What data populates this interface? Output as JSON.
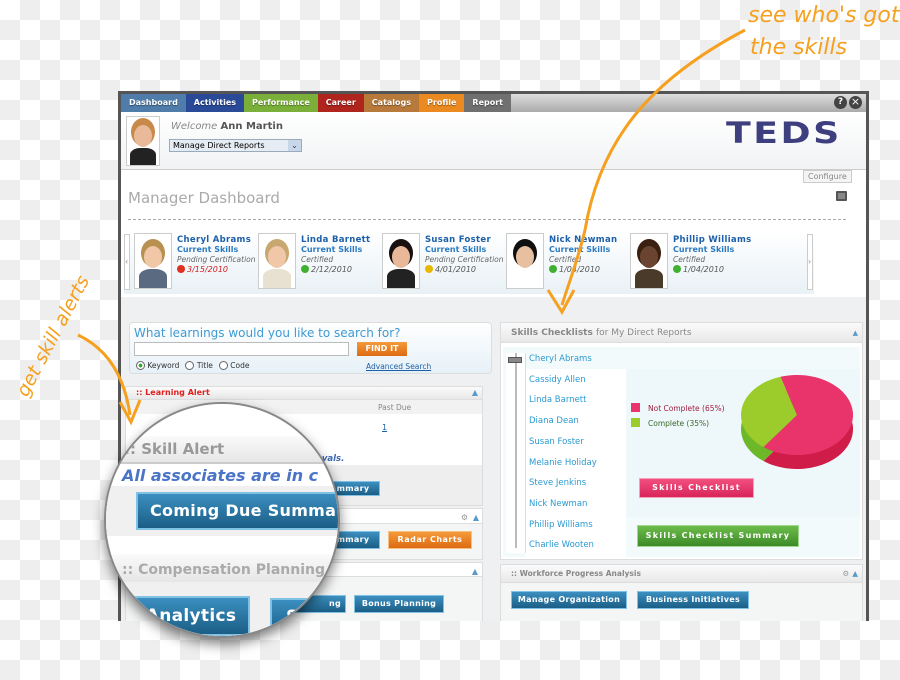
{
  "annotations": {
    "top_right": [
      "see who's got",
      "the skills"
    ],
    "left": "get skill alerts"
  },
  "nav": {
    "tabs": [
      {
        "label": "Dashboard",
        "color": "#4f7ca8"
      },
      {
        "label": "Activities",
        "color": "#2a4a98"
      },
      {
        "label": "Performance",
        "color": "#7ab03a"
      },
      {
        "label": "Career",
        "color": "#b0241e"
      },
      {
        "label": "Catalogs",
        "color": "#b87a3a"
      },
      {
        "label": "Profile",
        "color": "#ec8a22"
      },
      {
        "label": "Report",
        "color": "#707070"
      }
    ]
  },
  "header": {
    "welcome": "Welcome",
    "user": "Ann Martin",
    "select_value": "Manage Direct Reports",
    "logo": "TEDS",
    "help": "?",
    "close": "×"
  },
  "page": {
    "title": "Manager Dashboard",
    "configure": "Configure"
  },
  "people": [
    {
      "name": "Cheryl Abrams",
      "skills": "Current Skills",
      "status": "Pending Certification",
      "date": "3/15/2010",
      "dot": "#e03020",
      "date_color": "#d02020"
    },
    {
      "name": "Linda Barnett",
      "skills": "Current Skills",
      "status": "Certified",
      "date": "2/12/2010",
      "dot": "#40b030",
      "date_color": "#555"
    },
    {
      "name": "Susan Foster",
      "skills": "Current Skills",
      "status": "Pending Certification",
      "date": "4/01/2010",
      "dot": "#e8b800",
      "date_color": "#555"
    },
    {
      "name": "Nick Newman",
      "skills": "Current Skills",
      "status": "Certified",
      "date": "1/04/2010",
      "dot": "#40b030",
      "date_color": "#555"
    },
    {
      "name": "Phillip Williams",
      "skills": "Current Skills",
      "status": "Certified",
      "date": "1/04/2010",
      "dot": "#40b030",
      "date_color": "#555"
    }
  ],
  "search": {
    "prompt": "What learnings would you like to search for?",
    "value": "",
    "button": "FIND IT",
    "options": [
      "Keyword",
      "Title",
      "Code"
    ],
    "selected": "Keyword",
    "advanced": "Advanced Search"
  },
  "learning_alert": {
    "title": ":: Learning Alert",
    "col": "Past Due",
    "value": "1",
    "fragment": "ovals.",
    "btn_fragment": "mmary",
    "btn2_fragment": "mmary",
    "radar": "Radar Charts"
  },
  "compensation": {
    "bonus": "Bonus Planning",
    "fragment": "ng"
  },
  "magnifier": {
    "skill_alert": ":: Skill Alert",
    "message": "All associates are in c",
    "coming_due": "Coming Due Summa",
    "comp": ":: Compensation Planning",
    "analytics": "Analytics",
    "sal": "Sa"
  },
  "skills": {
    "title": "Skills Checklists",
    "subtitle": "for My Direct Reports",
    "list": [
      "Cheryl Abrams",
      "Cassidy Allen",
      "Linda Barnett",
      "Diana Dean",
      "Susan Foster",
      "Melanie Holiday",
      "Steve Jenkins",
      "Nick Newman",
      "Phillip Williams",
      "Charlie Wooten"
    ],
    "selected": "Cheryl Abrams",
    "btn_checklist": "Skills Checklist",
    "btn_summary": "Skills Checklist Summary"
  },
  "chart_data": {
    "type": "pie",
    "categories": [
      "Not Complete (65%)",
      "Complete (35%)"
    ],
    "values": [
      65,
      35
    ],
    "colors": [
      "#e8346a",
      "#9ccc2c"
    ],
    "legend": "left"
  },
  "workforce": {
    "title": ":: Workforce Progress Analysis",
    "buttons": [
      "Manage Organization",
      "Business Initiatives"
    ]
  }
}
